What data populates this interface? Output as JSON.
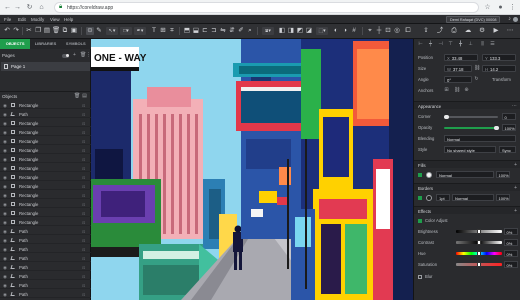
{
  "browser": {
    "url": "https://corel.draw.app",
    "url_display": "https://coreldraw.app"
  },
  "menubar": {
    "items": [
      "File",
      "Edit",
      "Modify",
      "View",
      "Help"
    ],
    "user": "Demi Rafaqat (DVC) 00008"
  },
  "left_panel": {
    "tabs": [
      "OBJECTS",
      "LIBRARIES",
      "SYMBOLS"
    ],
    "pages_title": "Pages",
    "page_item": "Page 1",
    "objects_title": "Objects",
    "objects": [
      {
        "type": "rect",
        "name": "Rectangle"
      },
      {
        "type": "path",
        "name": "Path"
      },
      {
        "type": "rect",
        "name": "Rectangle"
      },
      {
        "type": "rect",
        "name": "Rectangle"
      },
      {
        "type": "rect",
        "name": "Rectangle"
      },
      {
        "type": "rect",
        "name": "Rectangle"
      },
      {
        "type": "rect",
        "name": "Rectangle"
      },
      {
        "type": "rect",
        "name": "Rectangle"
      },
      {
        "type": "rect",
        "name": "Rectangle"
      },
      {
        "type": "rect",
        "name": "Rectangle"
      },
      {
        "type": "rect",
        "name": "Rectangle"
      },
      {
        "type": "rect",
        "name": "Rectangle"
      },
      {
        "type": "rect",
        "name": "Rectangle"
      },
      {
        "type": "rect",
        "name": "Rectangle"
      },
      {
        "type": "path",
        "name": "Path"
      },
      {
        "type": "path",
        "name": "Path"
      },
      {
        "type": "path",
        "name": "Path"
      },
      {
        "type": "path",
        "name": "Path"
      },
      {
        "type": "path",
        "name": "Path"
      },
      {
        "type": "path",
        "name": "Path"
      },
      {
        "type": "path",
        "name": "Path"
      },
      {
        "type": "path",
        "name": "Path"
      }
    ]
  },
  "canvas": {
    "sign_text": "ONE - WAY"
  },
  "right_panel": {
    "position_label": "Position",
    "pos_x": "33.48",
    "pos_y": "133.3",
    "size_label": "Size",
    "size_w": "37.18",
    "size_h": "14.2",
    "angle_label": "Angle",
    "angle_value": "0°",
    "transform_label": "Transform",
    "anchors_label": "Anchors",
    "appearance_title": "Appearance",
    "corner_label": "Corner",
    "corner_value": "0",
    "opacity_label": "Opacity",
    "opacity_value": "100%",
    "blending_label": "Blending",
    "blending_value": "Normal",
    "style_label": "Style",
    "style_value": "No shared style",
    "sync_label": "Sync",
    "fills_title": "Fills",
    "fill_mode": "Normal",
    "fill_opacity": "100%",
    "borders_title": "Borders",
    "border_width": "1pt",
    "border_mode": "Normal",
    "border_opacity": "100%",
    "effects_title": "Effects",
    "color_adjust_label": "Color Adjust",
    "adjust": [
      {
        "label": "Brightness",
        "value": "0%"
      },
      {
        "label": "Contrast",
        "value": "0%"
      },
      {
        "label": "Hue",
        "value": "0%"
      },
      {
        "label": "Saturation",
        "value": "0%"
      }
    ],
    "blur_label": "Blur"
  },
  "colors": {
    "accent": "#1f9e4c",
    "panel": "#2a2b2e",
    "toolbar": "#303134"
  }
}
